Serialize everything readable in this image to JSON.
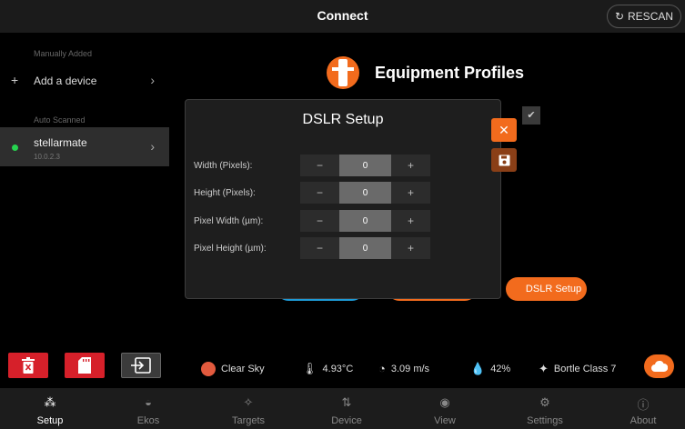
{
  "header": {
    "title": "Connect",
    "rescan_label": "RESCAN"
  },
  "sidebar": {
    "manual_section": "Manually Added",
    "add_device_label": "Add a device",
    "auto_section": "Auto Scanned",
    "device": {
      "name": "stellarmate",
      "ip": "10.0.2.3",
      "status_color": "#26d34f"
    }
  },
  "main": {
    "profile_title": "Equipment Profiles",
    "dslr_button_label": "DSLR Setup"
  },
  "modal": {
    "title": "DSLR Setup",
    "fields": [
      {
        "label": "Width (Pixels):",
        "value": "0",
        "dec": "−",
        "inc": "+"
      },
      {
        "label": "Height (Pixels):",
        "value": "0",
        "dec": "−",
        "inc": "+"
      },
      {
        "label": "Pixel Width (µm):",
        "value": "0",
        "dec": "−",
        "inc": "+"
      },
      {
        "label": "Pixel Height (µm):",
        "value": "0",
        "dec": "−",
        "inc": "+"
      }
    ]
  },
  "status": {
    "sky": "Clear Sky",
    "temperature": "4.93°C",
    "wind": "3.09 m/s",
    "humidity": "42%",
    "bortle": "Bortle Class 7"
  },
  "nav": [
    {
      "label": "Setup",
      "icon": "setup-icon",
      "active": true
    },
    {
      "label": "Ekos",
      "icon": "ekos-icon"
    },
    {
      "label": "Targets",
      "icon": "targets-icon"
    },
    {
      "label": "Device",
      "icon": "device-icon"
    },
    {
      "label": "View",
      "icon": "view-icon"
    },
    {
      "label": "Settings",
      "icon": "settings-icon"
    },
    {
      "label": "About",
      "icon": "about-icon"
    }
  ],
  "colors": {
    "accent": "#f26b1d",
    "danger": "#d6202a",
    "header": "#1b1b1b",
    "nav": "#1c1c1c"
  }
}
